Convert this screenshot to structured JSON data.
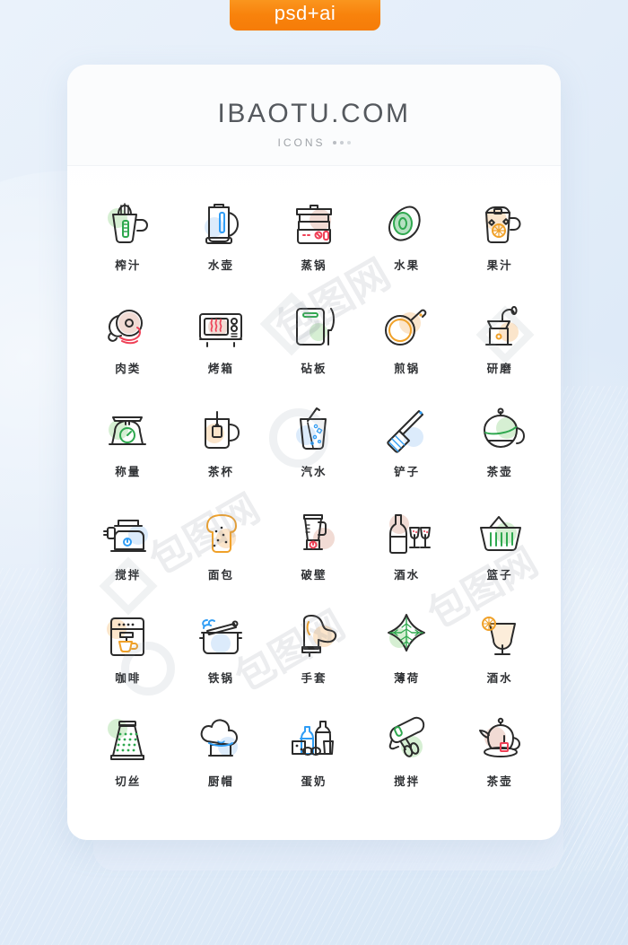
{
  "badge": {
    "label": "psd+ai",
    "color": "#f8820c"
  },
  "card": {
    "brand": "IBAOTU.COM",
    "subtitle": "ICONS"
  },
  "palette": {
    "stroke": "#2b2b2b",
    "green": "#2fa84f",
    "blue": "#2f9df5",
    "orange": "#f0a129",
    "red": "#ef4056",
    "blob_green": "#cfeccb",
    "blob_blue": "#d6e8fa",
    "blob_orange": "#fae1c2",
    "blob_pink": "#efd5cd"
  },
  "icons": [
    {
      "label": "榨汁",
      "name": "juicer-icon",
      "accent": "green"
    },
    {
      "label": "水壶",
      "name": "kettle-icon",
      "accent": "blue"
    },
    {
      "label": "蒸锅",
      "name": "steamer-icon",
      "accent": "pink"
    },
    {
      "label": "水果",
      "name": "avocado-icon",
      "accent": "green"
    },
    {
      "label": "果汁",
      "name": "juice-pitcher-icon",
      "accent": "orange"
    },
    {
      "label": "肉类",
      "name": "meat-icon",
      "accent": "pink"
    },
    {
      "label": "烤箱",
      "name": "oven-icon",
      "accent": "pink"
    },
    {
      "label": "砧板",
      "name": "cutting-board-icon",
      "accent": "green"
    },
    {
      "label": "煎锅",
      "name": "frying-pan-icon",
      "accent": "orange"
    },
    {
      "label": "研磨",
      "name": "coffee-grinder-icon",
      "accent": "orange"
    },
    {
      "label": "称量",
      "name": "kitchen-scale-icon",
      "accent": "green"
    },
    {
      "label": "茶杯",
      "name": "tea-cup-icon",
      "accent": "orange"
    },
    {
      "label": "汽水",
      "name": "soda-glass-icon",
      "accent": "blue"
    },
    {
      "label": "铲子",
      "name": "spatula-icon",
      "accent": "blue"
    },
    {
      "label": "茶壶",
      "name": "teapot-green-icon",
      "accent": "green"
    },
    {
      "label": "搅拌",
      "name": "meat-grinder-icon",
      "accent": "blue"
    },
    {
      "label": "面包",
      "name": "bread-slice-icon",
      "accent": "orange"
    },
    {
      "label": "破壁",
      "name": "blender-icon",
      "accent": "pink"
    },
    {
      "label": "酒水",
      "name": "wine-bottle-icon",
      "accent": "pink"
    },
    {
      "label": "篮子",
      "name": "shopping-basket-icon",
      "accent": "green"
    },
    {
      "label": "咖啡",
      "name": "coffee-machine-icon",
      "accent": "orange"
    },
    {
      "label": "铁锅",
      "name": "cooking-pot-icon",
      "accent": "blue"
    },
    {
      "label": "手套",
      "name": "oven-mitt-icon",
      "accent": "orange"
    },
    {
      "label": "薄荷",
      "name": "mint-leaf-icon",
      "accent": "green"
    },
    {
      "label": "酒水",
      "name": "cocktail-glass-icon",
      "accent": "orange"
    },
    {
      "label": "切丝",
      "name": "grater-icon",
      "accent": "green"
    },
    {
      "label": "厨帽",
      "name": "chef-hat-icon",
      "accent": "blue"
    },
    {
      "label": "蛋奶",
      "name": "dairy-eggs-icon",
      "accent": "blue"
    },
    {
      "label": "搅拌",
      "name": "hand-mixer-icon",
      "accent": "green"
    },
    {
      "label": "茶壶",
      "name": "teapot-red-icon",
      "accent": "pink"
    }
  ],
  "watermarks": [
    "包图网",
    "包图网",
    "包图网",
    "包图网"
  ]
}
